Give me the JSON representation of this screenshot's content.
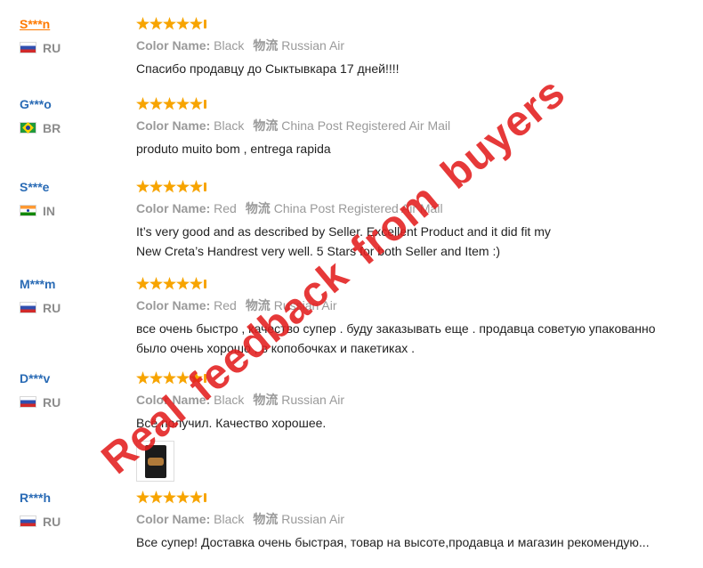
{
  "reviews": [
    {
      "user": "S***n",
      "country": "RU",
      "flag": "ru",
      "rating": 5,
      "color_label": "Color Name:",
      "color": "Black",
      "logistics_label": "物流",
      "logistics": "Russian Air",
      "text": "Спасибо продавцу до Сыктывкара 17 дней!!!!"
    },
    {
      "user": "G***o",
      "country": "BR",
      "flag": "br",
      "rating": 5,
      "color_label": "Color Name:",
      "color": "Black",
      "logistics_label": "物流",
      "logistics": "China Post Registered Air Mail",
      "text": "produto muito bom , entrega rapida"
    },
    {
      "user": "S***e",
      "country": "IN",
      "flag": "in",
      "rating": 5,
      "color_label": "Color Name:",
      "color": "Red",
      "logistics_label": "物流",
      "logistics": "China Post Registered Air Mail",
      "text_lines": [
        "It’s very good and as described by Seller. Excellent Product and it did fit my",
        "New Creta’s Handrest very well. 5 Stars for both Seller and Item :)"
      ]
    },
    {
      "user": "M***m",
      "country": "RU",
      "flag": "ru",
      "rating": 5,
      "color_label": "Color Name:",
      "color": "Red",
      "logistics_label": "物流",
      "logistics": "Russian Air",
      "text_lines": [
        "все очень быстро , качество супер . буду заказывать еще . продавца советую упакованно",
        "было очень хорошо , в копобочках и пакетиках ."
      ]
    },
    {
      "user": "D***v",
      "country": "RU",
      "flag": "ru",
      "rating": 5,
      "color_label": "Color Name:",
      "color": "Black",
      "logistics_label": "物流",
      "logistics": "Russian Air",
      "text": "Всё получил. Качество хорошее."
    },
    {
      "user": "R***h",
      "country": "RU",
      "flag": "ru",
      "rating": 5,
      "color_label": "Color Name:",
      "color": "Black",
      "logistics_label": "物流",
      "logistics": "Russian Air",
      "text": "Все супер! Доставка очень быстрая, товар на высоте,продавца и магазин рекомендую..."
    }
  ],
  "watermark": {
    "words": [
      "Real",
      "feedback",
      "from",
      "buyers"
    ],
    "color": "#e21e1e"
  },
  "colors": {
    "username": "#2a6bb5",
    "username_hover": "#ff7a00",
    "star": "#f7a400"
  }
}
